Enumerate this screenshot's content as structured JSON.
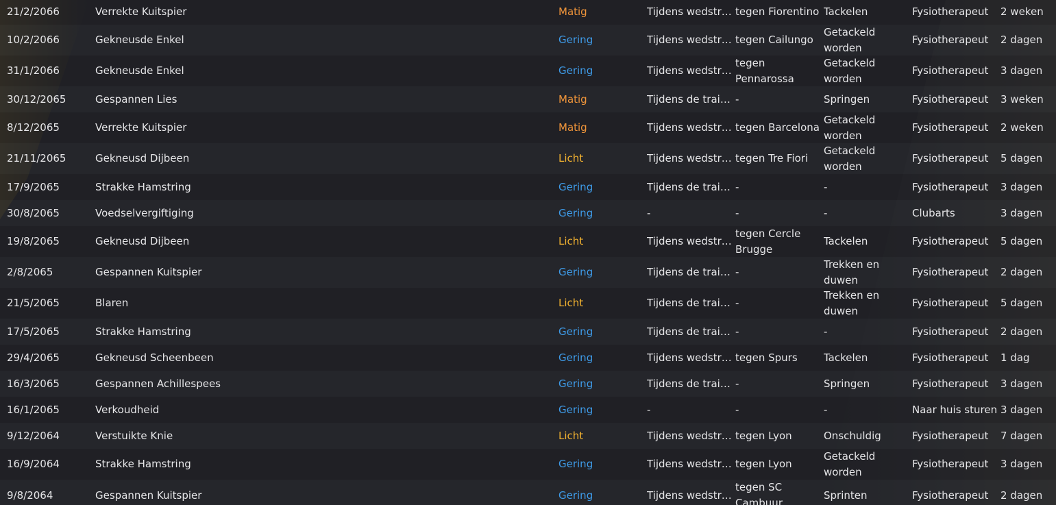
{
  "colors": {
    "matig": "#f0953a",
    "licht": "#f2b230",
    "gering": "#3e9be8",
    "background": "#1d1e22",
    "text": "#e6e6e8"
  },
  "injuries": [
    {
      "date": "21/2/2066",
      "injury": "Verrekte Kuitspier",
      "severity": "Matig",
      "when": "Tijdens wedstrijd",
      "match": "tegen Fiorentino",
      "cause": "Tackelen",
      "treatment": "Fysiotherapeut",
      "duration": "2 weken"
    },
    {
      "date": "10/2/2066",
      "injury": "Gekneusde Enkel",
      "severity": "Gering",
      "when": "Tijdens wedstrijd",
      "match": "tegen Cailungo",
      "cause": "Getackeld worden",
      "treatment": "Fysiotherapeut",
      "duration": "2 dagen"
    },
    {
      "date": "31/1/2066",
      "injury": "Gekneusde Enkel",
      "severity": "Gering",
      "when": "Tijdens wedstrijd",
      "match": "tegen Pennarossa",
      "cause": "Getackeld worden",
      "treatment": "Fysiotherapeut",
      "duration": "3 dagen"
    },
    {
      "date": "30/12/2065",
      "injury": "Gespannen Lies",
      "severity": "Matig",
      "when": "Tijdens de train...",
      "match": "-",
      "cause": "Springen",
      "treatment": "Fysiotherapeut",
      "duration": "3 weken"
    },
    {
      "date": "8/12/2065",
      "injury": "Verrekte Kuitspier",
      "severity": "Matig",
      "when": "Tijdens wedstrijd",
      "match": "tegen Barcelona",
      "cause": "Getackeld worden",
      "treatment": "Fysiotherapeut",
      "duration": "2 weken"
    },
    {
      "date": "21/11/2065",
      "injury": "Gekneusd Dijbeen",
      "severity": "Licht",
      "when": "Tijdens wedstrijd",
      "match": "tegen Tre Fiori",
      "cause": "Getackeld worden",
      "treatment": "Fysiotherapeut",
      "duration": "5 dagen"
    },
    {
      "date": "17/9/2065",
      "injury": "Strakke Hamstring",
      "severity": "Gering",
      "when": "Tijdens de train...",
      "match": "-",
      "cause": "-",
      "treatment": "Fysiotherapeut",
      "duration": "3 dagen"
    },
    {
      "date": "30/8/2065",
      "injury": "Voedselvergiftiging",
      "severity": "Gering",
      "when": "-",
      "match": "-",
      "cause": "-",
      "treatment": "Clubarts",
      "duration": "3 dagen"
    },
    {
      "date": "19/8/2065",
      "injury": "Gekneusd Dijbeen",
      "severity": "Licht",
      "when": "Tijdens wedstrijd",
      "match": "tegen Cercle Brugge",
      "cause": "Tackelen",
      "treatment": "Fysiotherapeut",
      "duration": "5 dagen"
    },
    {
      "date": "2/8/2065",
      "injury": "Gespannen Kuitspier",
      "severity": "Gering",
      "when": "Tijdens de train...",
      "match": "-",
      "cause": "Trekken en duwen",
      "treatment": "Fysiotherapeut",
      "duration": "2 dagen"
    },
    {
      "date": "21/5/2065",
      "injury": "Blaren",
      "severity": "Licht",
      "when": "Tijdens de train...",
      "match": "-",
      "cause": "Trekken en duwen",
      "treatment": "Fysiotherapeut",
      "duration": "5 dagen"
    },
    {
      "date": "17/5/2065",
      "injury": "Strakke Hamstring",
      "severity": "Gering",
      "when": "Tijdens de train...",
      "match": "-",
      "cause": "-",
      "treatment": "Fysiotherapeut",
      "duration": "2 dagen"
    },
    {
      "date": "29/4/2065",
      "injury": "Gekneusd Scheenbeen",
      "severity": "Gering",
      "when": "Tijdens wedstrijd",
      "match": "tegen Spurs",
      "cause": "Tackelen",
      "treatment": "Fysiotherapeut",
      "duration": "1 dag"
    },
    {
      "date": "16/3/2065",
      "injury": "Gespannen Achillespees",
      "severity": "Gering",
      "when": "Tijdens de train...",
      "match": "-",
      "cause": "Springen",
      "treatment": "Fysiotherapeut",
      "duration": "3 dagen"
    },
    {
      "date": "16/1/2065",
      "injury": "Verkoudheid",
      "severity": "Gering",
      "when": "-",
      "match": "-",
      "cause": "-",
      "treatment": "Naar huis sturen",
      "duration": "3 dagen"
    },
    {
      "date": "9/12/2064",
      "injury": "Verstuikte Knie",
      "severity": "Licht",
      "when": "Tijdens wedstrijd",
      "match": "tegen Lyon",
      "cause": "Onschuldig",
      "treatment": "Fysiotherapeut",
      "duration": "7 dagen"
    },
    {
      "date": "16/9/2064",
      "injury": "Strakke Hamstring",
      "severity": "Gering",
      "when": "Tijdens wedstrijd",
      "match": "tegen Lyon",
      "cause": "Getackeld worden",
      "treatment": "Fysiotherapeut",
      "duration": "3 dagen"
    },
    {
      "date": "9/8/2064",
      "injury": "Gespannen Kuitspier",
      "severity": "Gering",
      "when": "Tijdens wedstrijd",
      "match": "tegen SC Cambuur",
      "cause": "Sprinten",
      "treatment": "Fysiotherapeut",
      "duration": "2 dagen"
    }
  ]
}
